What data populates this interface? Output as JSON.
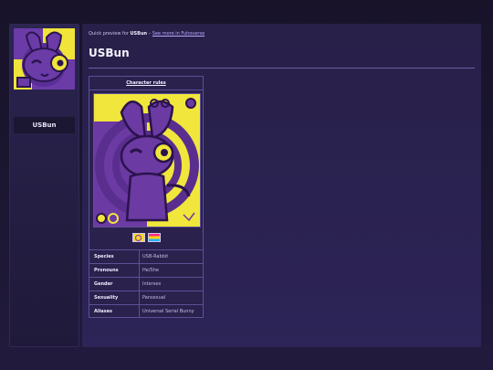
{
  "sidebar": {
    "avatar_icon": "usbun-avatar-icon",
    "name": "USBun"
  },
  "header": {
    "breadcrumb_prefix": "Quick preview for",
    "breadcrumb_name": "USBun",
    "breadcrumb_sep": "–",
    "breadcrumb_link": "See more in Fuhoverse"
  },
  "main": {
    "title": "USBun"
  },
  "card": {
    "header": "Character rules",
    "art_icon": "character-artwork",
    "flags": [
      {
        "name": "intersex-flag",
        "colors": [
          "#f5d72c",
          "#7d2fb3"
        ]
      },
      {
        "name": "pansexual-flag",
        "colors": [
          "#ff2a8a",
          "#ffd800",
          "#21b1ff"
        ]
      }
    ],
    "rows": [
      {
        "key": "Species",
        "value": "USB-Rabbit"
      },
      {
        "key": "Pronouns",
        "value": "He/She"
      },
      {
        "key": "Gender",
        "value": "Intersex"
      },
      {
        "key": "Sexuality",
        "value": "Pansexual"
      },
      {
        "key": "Aliases",
        "value": "Universal Serial Bunny"
      }
    ]
  },
  "colors": {
    "accent": "#b8a9ff",
    "art_purple": "#6c3aa3",
    "art_yellow": "#f1e63b"
  }
}
